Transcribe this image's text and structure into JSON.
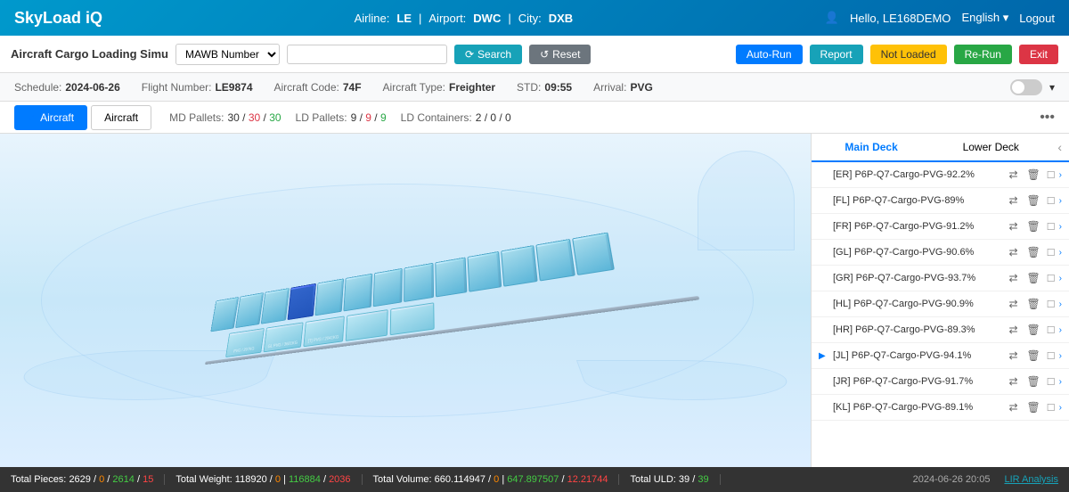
{
  "header": {
    "logo": "SkyLoad iQ",
    "airline_label": "Airline:",
    "airline_value": "LE",
    "airport_label": "Airport:",
    "airport_value": "DWC",
    "city_label": "City:",
    "city_value": "DXB",
    "user_icon": "👤",
    "user_greeting": "Hello, LE168DEMO",
    "language": "English",
    "logout": "Logout"
  },
  "toolbar": {
    "title": "Aircraft Cargo Loading Simu",
    "mawb_label": "MAWB Number",
    "search_placeholder": "",
    "search_label": "Search",
    "reset_label": "Reset",
    "autorun_label": "Auto-Run",
    "report_label": "Report",
    "notloaded_label": "Not Loaded",
    "rerun_label": "Re-Run",
    "exit_label": "Exit"
  },
  "info_bar": {
    "schedule_label": "Schedule:",
    "schedule_value": "2024-06-26",
    "flight_label": "Flight Number:",
    "flight_value": "LE9874",
    "aircraft_code_label": "Aircraft Code:",
    "aircraft_code_value": "74F",
    "aircraft_type_label": "Aircraft Type:",
    "aircraft_type_value": "Freighter",
    "std_label": "STD:",
    "std_value": "09:55",
    "arrival_label": "Arrival:",
    "arrival_value": "PVG"
  },
  "sub_toolbar": {
    "tab1_label": "Aircraft",
    "tab2_label": "Aircraft",
    "md_pallets_label": "MD Pallets:",
    "md_pallets_value": "30 / 30 / 30",
    "ld_pallets_label": "LD Pallets:",
    "ld_pallets_value": "9 / 9 / 9",
    "ld_containers_label": "LD Containers:",
    "ld_containers_value": "2 / 0 / 0"
  },
  "panel": {
    "main_deck_label": "Main Deck",
    "lower_deck_label": "Lower Deck",
    "items": [
      {
        "id": "ER",
        "label": "[ER] P6P-Q7-Cargo-PVG-92.2%",
        "active": false
      },
      {
        "id": "FL",
        "label": "[FL] P6P-Q7-Cargo-PVG-89%",
        "active": false
      },
      {
        "id": "FR",
        "label": "[FR] P6P-Q7-Cargo-PVG-91.2%",
        "active": false
      },
      {
        "id": "GL",
        "label": "[GL] P6P-Q7-Cargo-PVG-90.6%",
        "active": false
      },
      {
        "id": "GR",
        "label": "[GR] P6P-Q7-Cargo-PVG-93.7%",
        "active": false
      },
      {
        "id": "HL",
        "label": "[HL] P6P-Q7-Cargo-PVG-90.9%",
        "active": false
      },
      {
        "id": "HR",
        "label": "[HR] P6P-Q7-Cargo-PVG-89.3%",
        "active": false
      },
      {
        "id": "JL",
        "label": "[JL] P6P-Q7-Cargo-PVG-94.1%",
        "active": true
      },
      {
        "id": "JR",
        "label": "[JR] P6P-Q7-Cargo-PVG-91.7%",
        "active": false
      },
      {
        "id": "KL",
        "label": "[KL] P6P-Q7-Cargo-PVG-89.1%",
        "active": false
      }
    ]
  },
  "status_bar": {
    "pieces_label": "Total Pieces:",
    "pieces_value": "2629",
    "pieces_orange": "0",
    "pieces_green": "2614",
    "pieces_red": "15",
    "weight_label": "Total Weight:",
    "weight_value": "118920",
    "weight_orange": "0",
    "weight_green": "116884",
    "weight_red": "2036",
    "volume_label": "Total Volume:",
    "volume_value": "660.114947",
    "volume_orange": "0",
    "volume_green": "647.897507",
    "volume_red": "12.21744",
    "uld_label": "Total ULD:",
    "uld_value": "39",
    "uld_green": "39",
    "datetime": "2024-06-26 20:05",
    "lir_label": "LIR Analysis"
  },
  "colors": {
    "brand_blue": "#0099cc",
    "accent": "#007bff",
    "cargo_blue": "#7ec8e3",
    "cargo_highlight": "#4488ff"
  }
}
